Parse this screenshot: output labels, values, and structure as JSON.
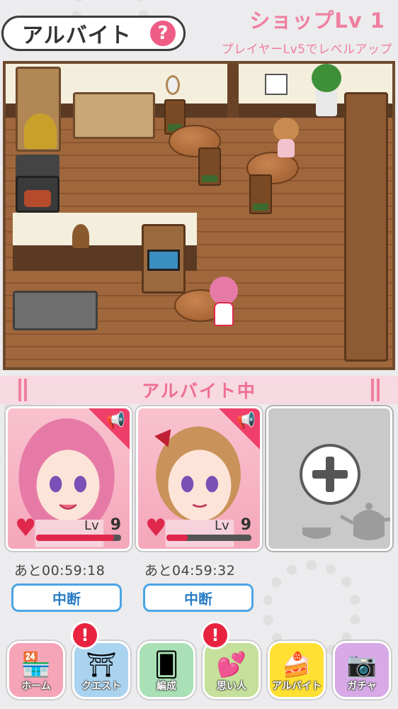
{
  "header": {
    "title": "アルバイト",
    "help_symbol": "?",
    "shop_level": "ショップLv 1",
    "shop_hint": "プレイヤーLv5でレベルアップ"
  },
  "banner": {
    "label": "アルバイト中"
  },
  "cards": [
    {
      "level_label": "Lv",
      "level": "9",
      "hp": 0.92,
      "timer": "あと00:59:18",
      "stop_label": "中断",
      "hair": "#e67aa6"
    },
    {
      "level_label": "Lv",
      "level": "9",
      "hp": 0.25,
      "timer": "あと04:59:32",
      "stop_label": "中断",
      "hair": "#c8925a"
    }
  ],
  "empty_slot": {
    "action": "+"
  },
  "nav": [
    {
      "label": "ホーム",
      "icon": "shop-icon",
      "glyph": "🏪",
      "color": "#f6a4b8",
      "alert": false
    },
    {
      "label": "クエスト",
      "icon": "gate-icon",
      "glyph": "⛩",
      "color": "#a9d3ef",
      "alert": true
    },
    {
      "label": "編成",
      "icon": "cards-icon",
      "glyph": "🂠",
      "color": "#a9e0b5",
      "alert": false
    },
    {
      "label": "思い人",
      "icon": "hearts-icon",
      "glyph": "💕",
      "color": "#c5e09a",
      "alert": true
    },
    {
      "label": "アルバイト",
      "icon": "waitress-icon",
      "glyph": "🍰",
      "color": "#ffe033",
      "alert": false
    },
    {
      "label": "ガチャ",
      "icon": "camera-icon",
      "glyph": "📷",
      "color": "#d7a9e6",
      "alert": false
    }
  ],
  "alert_symbol": "!",
  "colors": {
    "accent_pink": "#ef7fa0",
    "stop_blue": "#2b7dc6",
    "heart_red": "#e0284c"
  }
}
